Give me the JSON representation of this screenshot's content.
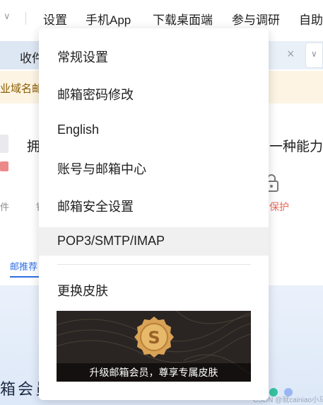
{
  "topnav": {
    "items": [
      "设置",
      "手机App",
      "下载桌面端",
      "参与调研",
      "自助"
    ]
  },
  "tabs": {
    "current_label": "收件",
    "close_symbol": "×",
    "dropdown_symbol": "∨"
  },
  "notice": {
    "text": "业域名邮"
  },
  "content": {
    "heading_left": "拥",
    "heading_right": "一种能力",
    "label_left": "件",
    "label_left2": "钱",
    "label_right": "保护",
    "rec_tab": "邮推荐",
    "banner_text": "箱会员"
  },
  "menu": {
    "items": [
      "常规设置",
      "邮箱密码修改",
      "English",
      "账号与邮箱中心",
      "邮箱安全设置",
      "POP3/SMTP/IMAP"
    ],
    "highlighted_index": 5,
    "skin_label": "更换皮肤",
    "skin_caption": "升级邮箱会员，尊享专属皮肤"
  },
  "watermark": "CSDN @就cainiao小马",
  "colors": {
    "accent_blue": "#2f6fe4",
    "notice_bg": "#fdf4e3",
    "menu_highlight": "#f0f0f0",
    "gold": "#d8a257"
  }
}
